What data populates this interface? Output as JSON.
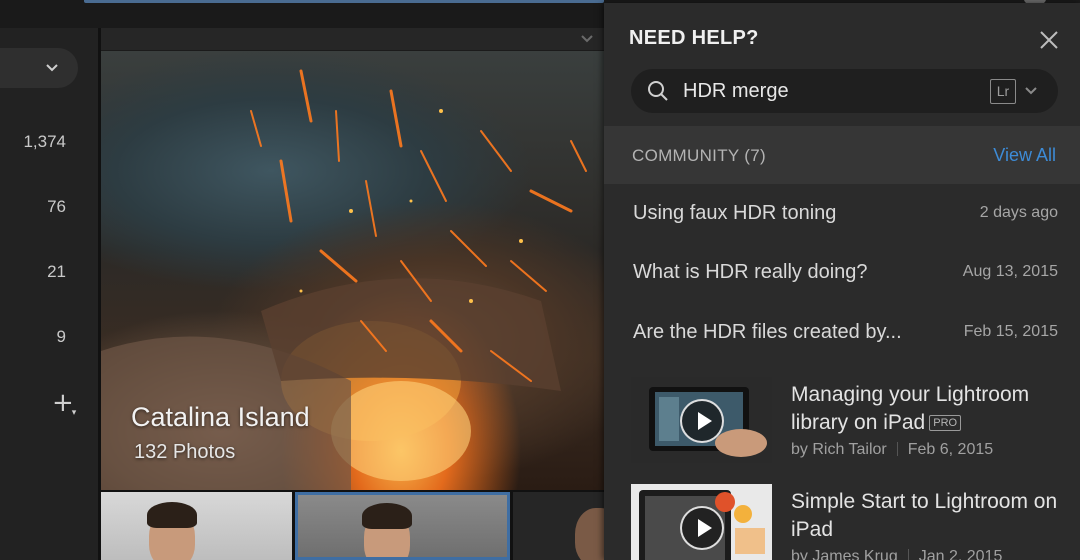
{
  "sidebar": {
    "counts": [
      "1,374",
      "76",
      "21",
      "9"
    ],
    "add_label": "+"
  },
  "album": {
    "title": "Catalina Island",
    "subtitle": "132 Photos"
  },
  "help": {
    "title": "NEED HELP?",
    "search": {
      "value": "HDR merge",
      "product_badge": "Lr"
    },
    "community": {
      "label": "COMMUNITY (7)",
      "view_all": "View All"
    },
    "posts": [
      {
        "title": "Using faux HDR toning",
        "date": "2 days ago"
      },
      {
        "title": "What is HDR really doing?",
        "date": "Aug 13, 2015"
      },
      {
        "title": "Are the HDR files created by...",
        "date": "Feb 15, 2015"
      }
    ],
    "videos": [
      {
        "title": "Managing your Lightroom library on iPad",
        "badge": "PRO",
        "author": "by Rich Tailor",
        "date": "Feb 6, 2015"
      },
      {
        "title": "Simple Start to Lightroom on iPad",
        "author": "by James Krug",
        "date": "Jan 2, 2015"
      }
    ]
  },
  "colors": {
    "accent": "#3d8bd6",
    "panel": "#2b2b2b",
    "community_bar": "#363636",
    "selected_thumb_border": "#3f6ea3"
  }
}
